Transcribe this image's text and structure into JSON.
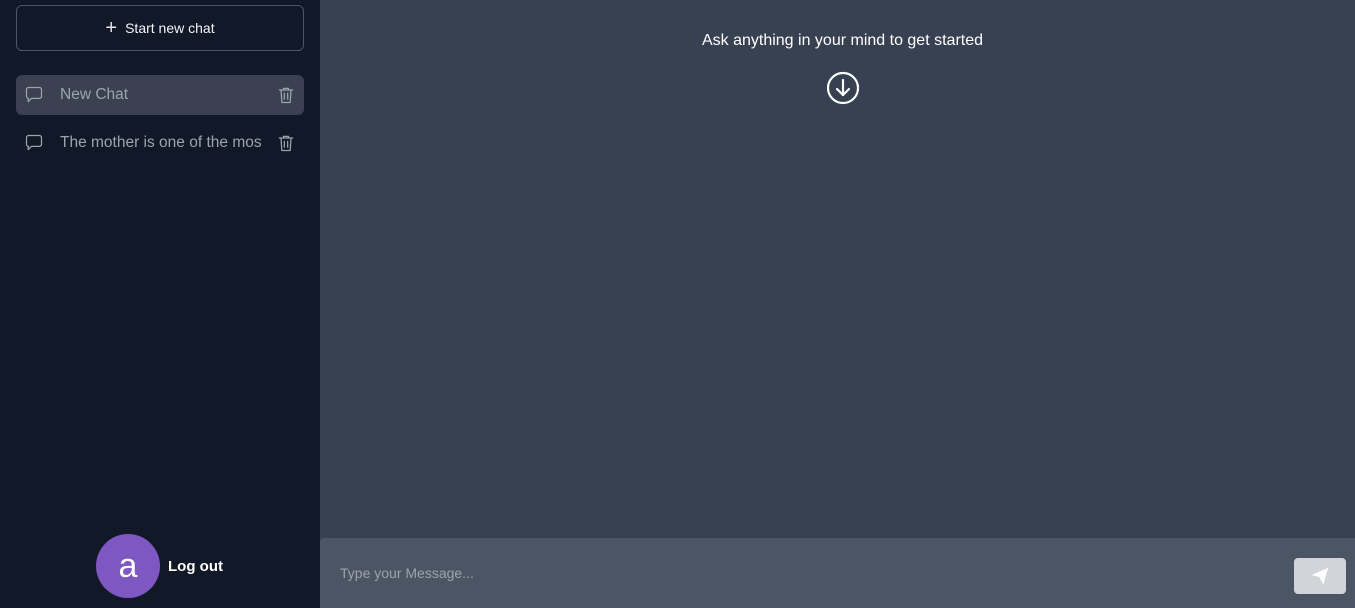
{
  "sidebar": {
    "new_chat_label": "Start new chat",
    "new_chat_icon": "plus-icon",
    "chats": [
      {
        "label": "New Chat",
        "active": true,
        "icon": "chat-bubble-icon",
        "action_icon": "trash-icon"
      },
      {
        "label": "The mother is one of the most",
        "active": false,
        "icon": "chat-bubble-icon",
        "action_icon": "trash-icon"
      }
    ],
    "user": {
      "avatar_letter": "a",
      "avatar_color": "#7e57c2",
      "logout_label": "Log out"
    }
  },
  "main": {
    "prompt_text": "Ask anything in your mind to get started",
    "prompt_icon": "arrow-down-circle-icon",
    "composer": {
      "placeholder": "Type your Message...",
      "value": "",
      "send_icon": "send-icon"
    }
  },
  "colors": {
    "sidebar_bg": "#111827",
    "main_bg": "#374151",
    "active_item_bg": "#3b4150",
    "composer_bg": "#4b5563",
    "send_button_bg": "#d1d5db"
  }
}
